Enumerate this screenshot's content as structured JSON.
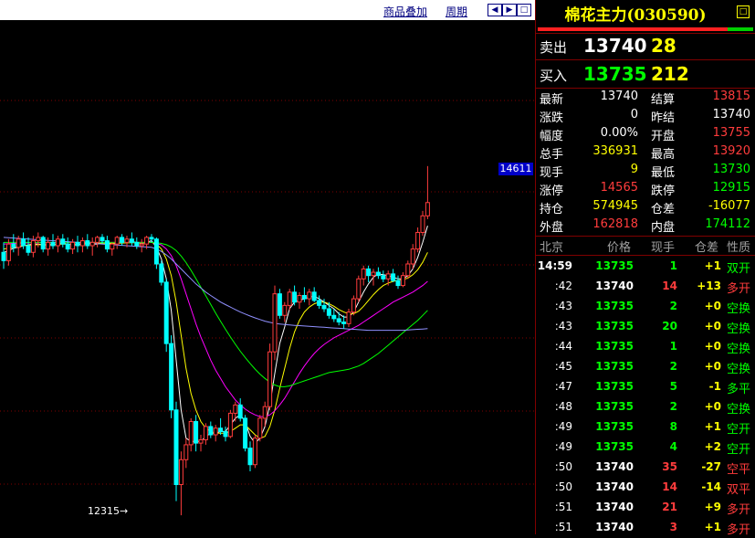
{
  "colors": {
    "up": "#ff3c3c",
    "down": "#00ff00",
    "neutral": "#ffffff",
    "yellow": "#ffff00",
    "cyan": "#00ffff",
    "grid": "#800000"
  },
  "toolbar": {
    "overlay_label": "商品叠加",
    "period_label": "周期",
    "nav_icons": [
      "arrow-left-icon",
      "arrow-right-icon",
      "expand-icon"
    ]
  },
  "chart": {
    "price_tag": "14611",
    "low_label": "12315→",
    "candles": [
      [
        13900,
        13960,
        13800,
        13850
      ],
      [
        13850,
        13980,
        13820,
        13950
      ],
      [
        13950,
        14010,
        13900,
        13930
      ],
      [
        13930,
        14000,
        13880,
        13980
      ],
      [
        13980,
        14020,
        13920,
        13940
      ],
      [
        13940,
        13990,
        13880,
        13900
      ],
      [
        13900,
        14000,
        13870,
        13970
      ],
      [
        13970,
        14020,
        13930,
        13990
      ],
      [
        13990,
        14000,
        13900,
        13920
      ],
      [
        13920,
        13990,
        13880,
        13960
      ],
      [
        13960,
        14010,
        13920,
        13940
      ],
      [
        13940,
        14000,
        13900,
        13980
      ],
      [
        13980,
        14010,
        13930,
        13950
      ],
      [
        13950,
        13990,
        13900,
        13920
      ],
      [
        13920,
        13980,
        13890,
        13960
      ],
      [
        13960,
        14000,
        13900,
        13940
      ],
      [
        13940,
        13990,
        13900,
        13970
      ],
      [
        13970,
        14010,
        13920,
        13940
      ],
      [
        13940,
        13990,
        13880,
        13960
      ],
      [
        13960,
        14000,
        13930,
        13990
      ],
      [
        13990,
        14010,
        13950,
        13970
      ],
      [
        13970,
        14000,
        13900,
        13920
      ],
      [
        13920,
        13960,
        13880,
        13950
      ],
      [
        13950,
        14000,
        13920,
        13990
      ],
      [
        13990,
        14010,
        13940,
        13960
      ],
      [
        13960,
        14000,
        13930,
        13980
      ],
      [
        13980,
        14020,
        13940,
        13960
      ],
      [
        13960,
        13990,
        13920,
        13940
      ],
      [
        13940,
        13980,
        13900,
        13950
      ],
      [
        13950,
        14000,
        13920,
        13990
      ],
      [
        13990,
        14010,
        13960,
        13980
      ],
      [
        13980,
        13990,
        13800,
        13830
      ],
      [
        13830,
        13850,
        13700,
        13720
      ],
      [
        13720,
        13740,
        13300,
        13350
      ],
      [
        13350,
        13400,
        12900,
        12950
      ],
      [
        12950,
        13000,
        12400,
        12500
      ],
      [
        12500,
        12700,
        12315,
        12650
      ],
      [
        12650,
        12780,
        12600,
        12740
      ],
      [
        12740,
        12900,
        12700,
        12880
      ],
      [
        12880,
        12920,
        12700,
        12750
      ],
      [
        12750,
        12800,
        12700,
        12770
      ],
      [
        12770,
        12870,
        12740,
        12850
      ],
      [
        12850,
        12880,
        12780,
        12800
      ],
      [
        12800,
        12860,
        12760,
        12840
      ],
      [
        12840,
        12900,
        12800,
        12820
      ],
      [
        12820,
        12850,
        12760,
        12790
      ],
      [
        12790,
        12950,
        12780,
        12930
      ],
      [
        12930,
        13000,
        12880,
        12980
      ],
      [
        12980,
        13020,
        12880,
        12900
      ],
      [
        12900,
        12920,
        12700,
        12720
      ],
      [
        12720,
        12760,
        12580,
        12620
      ],
      [
        12620,
        12800,
        12600,
        12780
      ],
      [
        12780,
        12920,
        12760,
        12900
      ],
      [
        12900,
        13000,
        12850,
        12970
      ],
      [
        12970,
        13350,
        12950,
        13300
      ],
      [
        13300,
        13700,
        13250,
        13650
      ],
      [
        13650,
        13680,
        13500,
        13520
      ],
      [
        13520,
        13600,
        13480,
        13580
      ],
      [
        13580,
        13680,
        13550,
        13660
      ],
      [
        13660,
        13700,
        13580,
        13600
      ],
      [
        13600,
        13660,
        13560,
        13640
      ],
      [
        13640,
        13690,
        13600,
        13620
      ],
      [
        13620,
        13680,
        13580,
        13660
      ],
      [
        13660,
        13690,
        13600,
        13610
      ],
      [
        13610,
        13640,
        13560,
        13580
      ],
      [
        13580,
        13620,
        13540,
        13560
      ],
      [
        13560,
        13600,
        13500,
        13520
      ],
      [
        13520,
        13560,
        13480,
        13500
      ],
      [
        13500,
        13540,
        13460,
        13480
      ],
      [
        13480,
        13520,
        13440,
        13470
      ],
      [
        13470,
        13560,
        13450,
        13540
      ],
      [
        13540,
        13640,
        13520,
        13620
      ],
      [
        13620,
        13760,
        13600,
        13740
      ],
      [
        13740,
        13820,
        13700,
        13800
      ],
      [
        13800,
        13820,
        13720,
        13760
      ],
      [
        13760,
        13800,
        13700,
        13780
      ],
      [
        13780,
        13810,
        13740,
        13760
      ],
      [
        13760,
        13790,
        13720,
        13740
      ],
      [
        13740,
        13790,
        13700,
        13770
      ],
      [
        13770,
        13800,
        13720,
        13730
      ],
      [
        13730,
        13760,
        13680,
        13700
      ],
      [
        13700,
        13780,
        13690,
        13760
      ],
      [
        13760,
        13850,
        13740,
        13830
      ],
      [
        13830,
        13950,
        13800,
        13920
      ],
      [
        13920,
        14050,
        13900,
        14020
      ],
      [
        14020,
        14150,
        14000,
        14120
      ],
      [
        14120,
        14420,
        14100,
        14200
      ]
    ],
    "ma_lines": [
      {
        "color": "#ffffff",
        "values": [
          13900,
          13910,
          13925,
          13930,
          13940,
          13945,
          13950,
          13950,
          13945,
          13945,
          13945,
          13950,
          13955,
          13950,
          13945,
          13945,
          13950,
          13955,
          13950,
          13950,
          13960,
          13955,
          13950,
          13955,
          13960,
          13960,
          13965,
          13960,
          13955,
          13960,
          13970,
          13930,
          13860,
          13740,
          13550,
          13250,
          12950,
          12780,
          12760,
          12760,
          12760,
          12790,
          12810,
          12810,
          12820,
          12820,
          12860,
          12900,
          12920,
          12880,
          12790,
          12750,
          12780,
          12850,
          12980,
          13170,
          13350,
          13450,
          13560,
          13600,
          13610,
          13620,
          13630,
          13635,
          13620,
          13600,
          13580,
          13560,
          13530,
          13510,
          13510,
          13540,
          13600,
          13660,
          13710,
          13750,
          13770,
          13765,
          13760,
          13750,
          13740,
          13740,
          13760,
          13800,
          13870,
          13960,
          14060
        ]
      },
      {
        "color": "#ffff00",
        "values": [
          13920,
          13925,
          13930,
          13935,
          13940,
          13942,
          13945,
          13946,
          13947,
          13947,
          13948,
          13948,
          13950,
          13950,
          13950,
          13950,
          13950,
          13952,
          13953,
          13953,
          13955,
          13955,
          13955,
          13955,
          13956,
          13957,
          13958,
          13958,
          13958,
          13958,
          13960,
          13950,
          13920,
          13860,
          13760,
          13600,
          13400,
          13200,
          13050,
          12950,
          12880,
          12840,
          12820,
          12810,
          12810,
          12810,
          12820,
          12840,
          12860,
          12860,
          12830,
          12800,
          12780,
          12790,
          12850,
          12950,
          13080,
          13200,
          13320,
          13420,
          13490,
          13540,
          13570,
          13590,
          13600,
          13600,
          13590,
          13575,
          13555,
          13540,
          13530,
          13530,
          13545,
          13575,
          13610,
          13645,
          13675,
          13700,
          13715,
          13725,
          13730,
          13735,
          13745,
          13765,
          13795,
          13840,
          13900
        ]
      },
      {
        "color": "#ff00ff",
        "values": [
          13950,
          13952,
          13954,
          13955,
          13956,
          13957,
          13958,
          13958,
          13959,
          13959,
          13959,
          13960,
          13960,
          13960,
          13960,
          13960,
          13960,
          13960,
          13960,
          13960,
          13960,
          13960,
          13960,
          13960,
          13960,
          13960,
          13960,
          13960,
          13960,
          13960,
          13960,
          13955,
          13945,
          13920,
          13880,
          13820,
          13740,
          13650,
          13560,
          13470,
          13390,
          13320,
          13250,
          13190,
          13140,
          13090,
          13050,
          13010,
          12980,
          12955,
          12935,
          12920,
          12910,
          12910,
          12920,
          12945,
          12980,
          13020,
          13070,
          13120,
          13170,
          13215,
          13255,
          13290,
          13320,
          13345,
          13365,
          13385,
          13400,
          13415,
          13430,
          13445,
          13460,
          13480,
          13500,
          13520,
          13540,
          13560,
          13580,
          13600,
          13615,
          13630,
          13645,
          13660,
          13680,
          13700,
          13725
        ]
      },
      {
        "color": "#00ff00",
        "values": [
          13960,
          13960,
          13960,
          13960,
          13960,
          13960,
          13960,
          13960,
          13960,
          13960,
          13960,
          13960,
          13960,
          13960,
          13960,
          13960,
          13960,
          13960,
          13960,
          13960,
          13960,
          13960,
          13960,
          13960,
          13960,
          13960,
          13960,
          13960,
          13960,
          13960,
          13960,
          13958,
          13954,
          13946,
          13932,
          13910,
          13878,
          13838,
          13792,
          13742,
          13690,
          13638,
          13586,
          13534,
          13484,
          13436,
          13390,
          13346,
          13304,
          13266,
          13230,
          13196,
          13166,
          13140,
          13118,
          13100,
          13090,
          13090,
          13095,
          13105,
          13115,
          13125,
          13135,
          13145,
          13155,
          13165,
          13175,
          13180,
          13185,
          13190,
          13195,
          13205,
          13215,
          13230,
          13250,
          13270,
          13290,
          13315,
          13340,
          13365,
          13390,
          13415,
          13440,
          13465,
          13490,
          13520,
          13550
        ]
      },
      {
        "color": "#9090ff",
        "values": [
          13990,
          13988,
          13986,
          13984,
          13982,
          13980,
          13978,
          13976,
          13974,
          13972,
          13970,
          13968,
          13966,
          13964,
          13962,
          13960,
          13958,
          13956,
          13954,
          13952,
          13950,
          13948,
          13946,
          13944,
          13942,
          13940,
          13938,
          13936,
          13934,
          13932,
          13930,
          13920,
          13905,
          13885,
          13860,
          13830,
          13800,
          13770,
          13740,
          13710,
          13685,
          13660,
          13640,
          13620,
          13600,
          13585,
          13570,
          13555,
          13540,
          13528,
          13516,
          13505,
          13495,
          13485,
          13478,
          13472,
          13468,
          13465,
          13462,
          13460,
          13458,
          13456,
          13454,
          13452,
          13450,
          13448,
          13446,
          13444,
          13442,
          13440,
          13438,
          13436,
          13434,
          13432,
          13430,
          13430,
          13430,
          13430,
          13430,
          13430,
          13430,
          13430,
          13432,
          13434,
          13436,
          13438,
          13440
        ]
      }
    ]
  },
  "quote": {
    "title": "棉花主力(030590)",
    "menu_icon": "menu-square-icon",
    "sell": {
      "label": "卖出",
      "price": "13740",
      "vol": "28"
    },
    "buy": {
      "label": "买入",
      "price": "13735",
      "vol": "212"
    },
    "stats": [
      {
        "l1": "最新",
        "v1": "13740",
        "c1": "#ffffff",
        "l2": "结算",
        "v2": "13815",
        "c2": "#ff3c3c"
      },
      {
        "l1": "涨跌",
        "v1": "0",
        "c1": "#ffffff",
        "l2": "昨结",
        "v2": "13740",
        "c2": "#ffffff"
      },
      {
        "l1": "幅度",
        "v1": "0.00%",
        "c1": "#ffffff",
        "l2": "开盘",
        "v2": "13755",
        "c2": "#ff3c3c"
      },
      {
        "l1": "总手",
        "v1": "336931",
        "c1": "#ffff00",
        "l2": "最高",
        "v2": "13920",
        "c2": "#ff3c3c"
      },
      {
        "l1": "现手",
        "v1": "9",
        "c1": "#ffff00",
        "l2": "最低",
        "v2": "13730",
        "c2": "#00ff00"
      },
      {
        "l1": "涨停",
        "v1": "14565",
        "c1": "#ff3c3c",
        "l2": "跌停",
        "v2": "12915",
        "c2": "#00ff00"
      },
      {
        "l1": "持仓",
        "v1": "574945",
        "c1": "#ffff00",
        "l2": "仓差",
        "v2": "-16077",
        "c2": "#ffff00"
      },
      {
        "l1": "外盘",
        "v1": "162818",
        "c1": "#ff3c3c",
        "l2": "内盘",
        "v2": "174112",
        "c2": "#00ff00"
      }
    ],
    "ticks_header": {
      "time": "北京",
      "price": "价格",
      "vol": "现手",
      "oi": "仓差",
      "nature": "性质"
    },
    "ticks": [
      {
        "time": "14:59",
        "price": "13735",
        "pc": "#00ff00",
        "vol": "1",
        "vc": "#00ff00",
        "oi": "+1",
        "nat": "双开",
        "nc": "#00ff00"
      },
      {
        "time": ":42",
        "price": "13740",
        "pc": "#ffffff",
        "vol": "14",
        "vc": "#ff3c3c",
        "oi": "+13",
        "nat": "多开",
        "nc": "#ff3c3c"
      },
      {
        "time": ":43",
        "price": "13735",
        "pc": "#00ff00",
        "vol": "2",
        "vc": "#00ff00",
        "oi": "+0",
        "nat": "空换",
        "nc": "#00ff00"
      },
      {
        "time": ":43",
        "price": "13735",
        "pc": "#00ff00",
        "vol": "20",
        "vc": "#00ff00",
        "oi": "+0",
        "nat": "空换",
        "nc": "#00ff00"
      },
      {
        "time": ":44",
        "price": "13735",
        "pc": "#00ff00",
        "vol": "1",
        "vc": "#00ff00",
        "oi": "+0",
        "nat": "空换",
        "nc": "#00ff00"
      },
      {
        "time": ":45",
        "price": "13735",
        "pc": "#00ff00",
        "vol": "2",
        "vc": "#00ff00",
        "oi": "+0",
        "nat": "空换",
        "nc": "#00ff00"
      },
      {
        "time": ":47",
        "price": "13735",
        "pc": "#00ff00",
        "vol": "5",
        "vc": "#00ff00",
        "oi": "-1",
        "nat": "多平",
        "nc": "#00ff00"
      },
      {
        "time": ":48",
        "price": "13735",
        "pc": "#00ff00",
        "vol": "2",
        "vc": "#00ff00",
        "oi": "+0",
        "nat": "空换",
        "nc": "#00ff00"
      },
      {
        "time": ":49",
        "price": "13735",
        "pc": "#00ff00",
        "vol": "8",
        "vc": "#00ff00",
        "oi": "+1",
        "nat": "空开",
        "nc": "#00ff00"
      },
      {
        "time": ":49",
        "price": "13735",
        "pc": "#00ff00",
        "vol": "4",
        "vc": "#00ff00",
        "oi": "+2",
        "nat": "空开",
        "nc": "#00ff00"
      },
      {
        "time": ":50",
        "price": "13740",
        "pc": "#ffffff",
        "vol": "35",
        "vc": "#ff3c3c",
        "oi": "-27",
        "nat": "空平",
        "nc": "#ff3c3c"
      },
      {
        "time": ":50",
        "price": "13740",
        "pc": "#ffffff",
        "vol": "14",
        "vc": "#ff3c3c",
        "oi": "-14",
        "nat": "双平",
        "nc": "#ff3c3c"
      },
      {
        "time": ":51",
        "price": "13740",
        "pc": "#ffffff",
        "vol": "21",
        "vc": "#ff3c3c",
        "oi": "+9",
        "nat": "多开",
        "nc": "#ff3c3c"
      },
      {
        "time": ":51",
        "price": "13740",
        "pc": "#ffffff",
        "vol": "3",
        "vc": "#ff3c3c",
        "oi": "+1",
        "nat": "多开",
        "nc": "#ff3c3c"
      }
    ]
  }
}
